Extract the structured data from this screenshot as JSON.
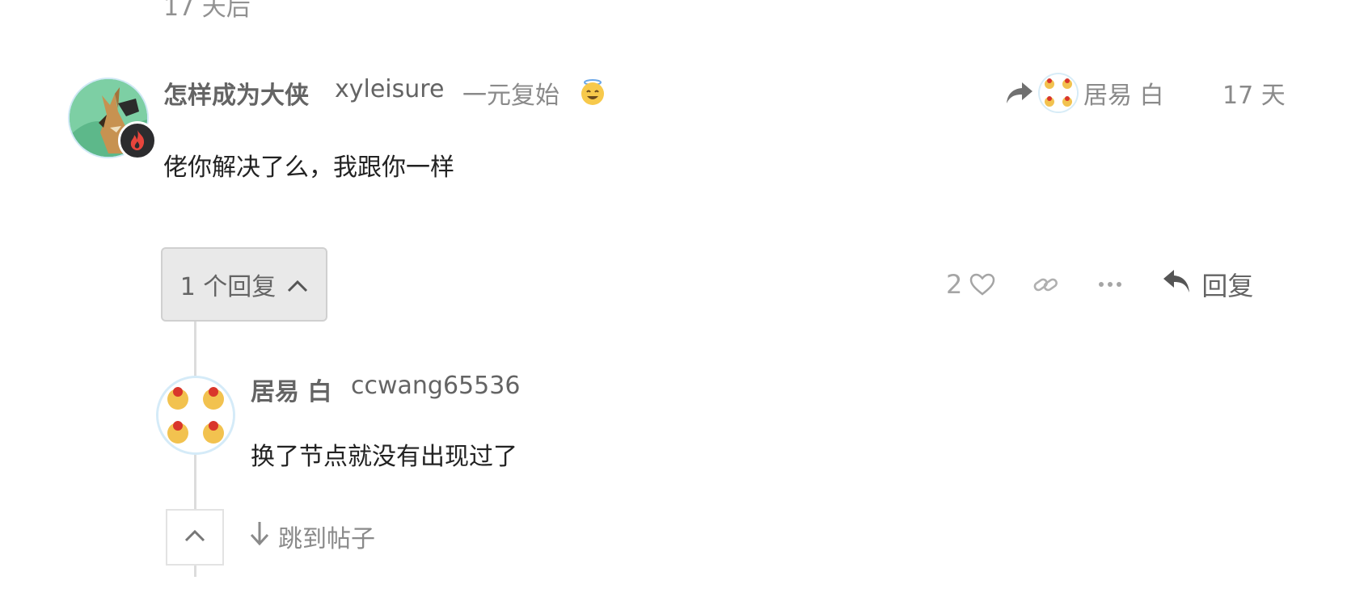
{
  "previous_post": {
    "time": "17 天后"
  },
  "post": {
    "display_name": "怎样成为大侠",
    "username": "xyleisure",
    "title": "一元复始",
    "status_emoji": "smiling-face-with-halo-icon",
    "reply_to_name": "居易 白",
    "date": "17 天",
    "content": "佬你解决了么，我跟你一样",
    "likes": "2",
    "replies_label": "1 个回复",
    "reply_label": "回复"
  },
  "reply": {
    "display_name": "居易 白",
    "username": "ccwang65536",
    "content": "换了节点就没有出现过了",
    "jump_label": "跳到帖子"
  },
  "colors": {
    "text": "#222222",
    "muted": "#8a8a8a",
    "username": "#646464",
    "button_bg": "#e9e9e9",
    "thread_line": "#dcdcdc"
  }
}
